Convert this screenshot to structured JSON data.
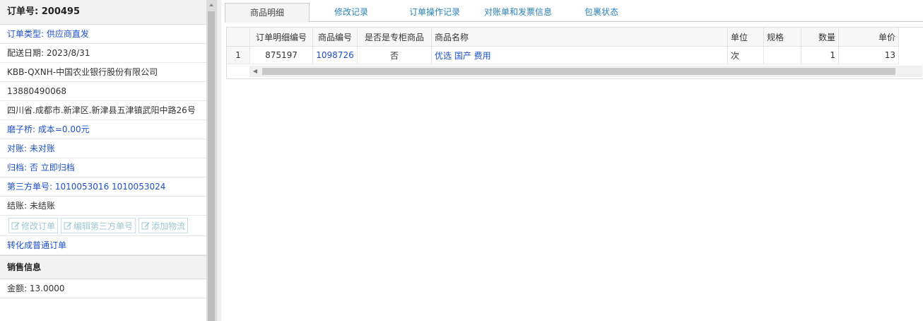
{
  "sidebar": {
    "order_title": "订单号: 200495",
    "order_type": "订单类型: 供应商直发",
    "delivery_date": "配送日期: 2023/8/31",
    "customer": "KBB-QXNH-中国农业银行股份有限公司",
    "phone": "13880490068",
    "address": "四川省.成都市.新津区.新津县五津镇武阳中路26号",
    "mozi": "磨子桥: 成本=0.00元",
    "reconcile": "对账: 未对账",
    "archive_label": "归档: ",
    "archive_value": "否",
    "archive_link": "立即归档",
    "third_party": "第三方单号: 1010053016 1010053024",
    "settle": "结账: 未结账",
    "buttons": {
      "edit_order": "修改订单",
      "edit_third": "编辑第三方单号",
      "add_logistics": "添加物流"
    },
    "convert_link": "转化成普通订单",
    "sales_section": "销售信息",
    "amount": "金额: 13.0000"
  },
  "tabs": [
    "商品明细",
    "修改记录",
    "订单操作记录",
    "对账单和发票信息",
    "包裹状态"
  ],
  "table": {
    "headers": [
      "订单明细编号",
      "商品编号",
      "是否是专柜商品",
      "商品名称",
      "单位",
      "规格",
      "数量",
      "单价"
    ],
    "rows": [
      {
        "index": "1",
        "detail_no": "875197",
        "product_no": "1098726",
        "is_counter": "否",
        "name": "优选 国产 费用",
        "unit": "次",
        "spec": "",
        "qty": "1",
        "price": "13"
      }
    ]
  },
  "colors": {
    "link": "#1e50c8",
    "tab_link": "#2a82b8"
  }
}
